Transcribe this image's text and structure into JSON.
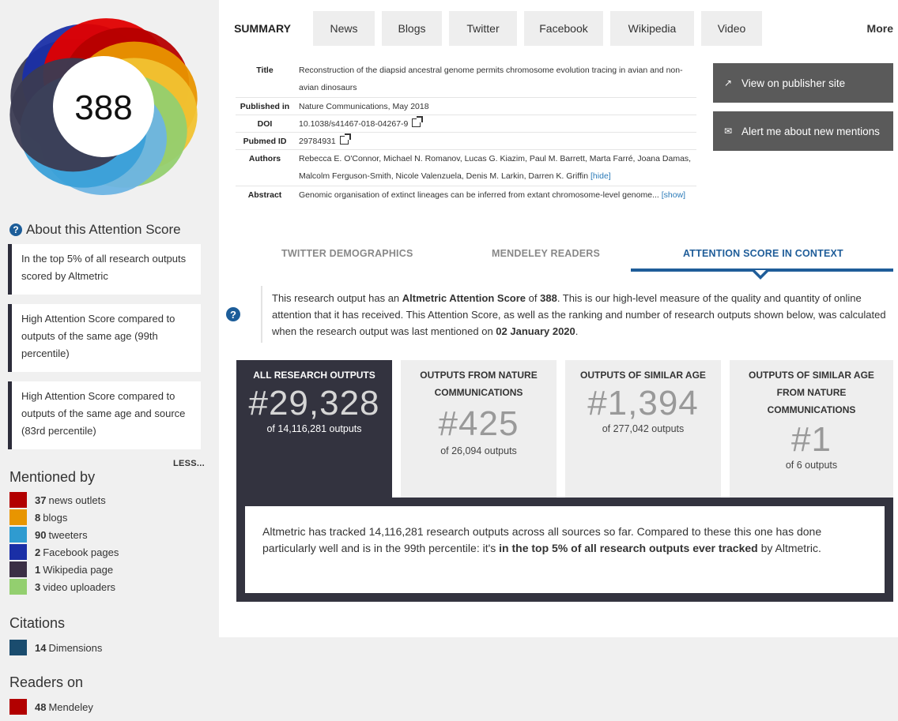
{
  "score": {
    "value": "388",
    "donut_colors": [
      "#b60000",
      "#e89500",
      "#f1c232",
      "#93cf6f",
      "#6db4e3",
      "#3aa0d8",
      "#3b3b52",
      "#1a2fa6",
      "#e00000",
      "#f5a623"
    ]
  },
  "about": {
    "heading": "About this Attention Score",
    "card1": "In the top 5% of all research outputs scored by Altmetric",
    "card2": "High Attention Score compared to outputs of the same age (99th percentile)",
    "card3": "High Attention Score compared to outputs of the same age and source (83rd percentile)",
    "less": "LESS..."
  },
  "mentioned_by": {
    "title": "Mentioned by",
    "items": [
      {
        "count": "37",
        "label": "news outlets",
        "color": "#b20000"
      },
      {
        "count": "8",
        "label": "blogs",
        "color": "#e89500"
      },
      {
        "count": "90",
        "label": "tweeters",
        "color": "#2f9bd0"
      },
      {
        "count": "2",
        "label": "Facebook pages",
        "color": "#1a2fa6"
      },
      {
        "count": "1",
        "label": "Wikipedia page",
        "color": "#3b2f45"
      },
      {
        "count": "3",
        "label": "video uploaders",
        "color": "#93cf6f"
      }
    ]
  },
  "citations": {
    "title": "Citations",
    "items": [
      {
        "count": "14",
        "label": "Dimensions",
        "color": "#1a4c6e"
      }
    ]
  },
  "readers": {
    "title": "Readers on",
    "items": [
      {
        "count": "48",
        "label": "Mendeley",
        "color": "#b20000"
      }
    ]
  },
  "tabs": [
    "SUMMARY",
    "News",
    "Blogs",
    "Twitter",
    "Facebook",
    "Wikipedia",
    "Video",
    "More"
  ],
  "details": {
    "title_label": "Title",
    "title_value": "Reconstruction of the diapsid ancestral genome permits chromosome evolution tracing in avian and non-avian dinosaurs",
    "published_label": "Published in",
    "published_value": "Nature Communications, May 2018",
    "doi_label": "DOI",
    "doi_value": "10.1038/s41467-018-04267-9",
    "pubmed_label": "Pubmed ID",
    "pubmed_value": "29784931",
    "authors_label": "Authors",
    "authors_value": "Rebecca E. O'Connor, Michael N. Romanov, Lucas G. Kiazim, Paul M. Barrett, Marta Farré, Joana Damas, Malcolm Ferguson-Smith, Nicole Valenzuela, Denis M. Larkin, Darren K. Griffin",
    "authors_toggle": "[hide]",
    "abstract_label": "Abstract",
    "abstract_value": "Genomic organisation of extinct lineages can be inferred from extant chromosome-level genome...",
    "abstract_toggle": "[show]"
  },
  "buttons": {
    "publisher": "View on publisher site",
    "alert": "Alert me about new mentions"
  },
  "subtabs": {
    "twitter": "TWITTER DEMOGRAPHICS",
    "mendeley": "MENDELEY READERS",
    "context": "ATTENTION SCORE IN CONTEXT"
  },
  "context": {
    "p1": "This research output has an ",
    "b1": "Altmetric Attention Score",
    "p2": " of ",
    "b2": "388",
    "p3": ". This is our high-level measure of the quality and quantity of online attention that it has received. This Attention Score, as well as the ranking and number of research outputs shown below, was calculated when the research output was last mentioned on ",
    "b3": "02 January 2020",
    "p4": "."
  },
  "ranks": [
    {
      "head": "ALL RESEARCH OUTPUTS",
      "num": "#29,328",
      "of": "of 14,116,281 outputs"
    },
    {
      "head": "OUTPUTS FROM NATURE COMMUNICATIONS",
      "num": "#425",
      "of": "of 26,094 outputs"
    },
    {
      "head": "OUTPUTS OF SIMILAR AGE",
      "num": "#1,394",
      "of": "of 277,042 outputs"
    },
    {
      "head": "OUTPUTS OF SIMILAR AGE FROM NATURE COMMUNICATIONS",
      "num": "#1",
      "of": "of 6 outputs"
    }
  ],
  "summary": {
    "p1": "Altmetric has tracked 14,116,281 research outputs across all sources so far. Compared to these this one has done particularly well and is in the 99th percentile: it's ",
    "b1": "in the top 5% of all research outputs ever tracked",
    "p2": " by Altmetric."
  }
}
